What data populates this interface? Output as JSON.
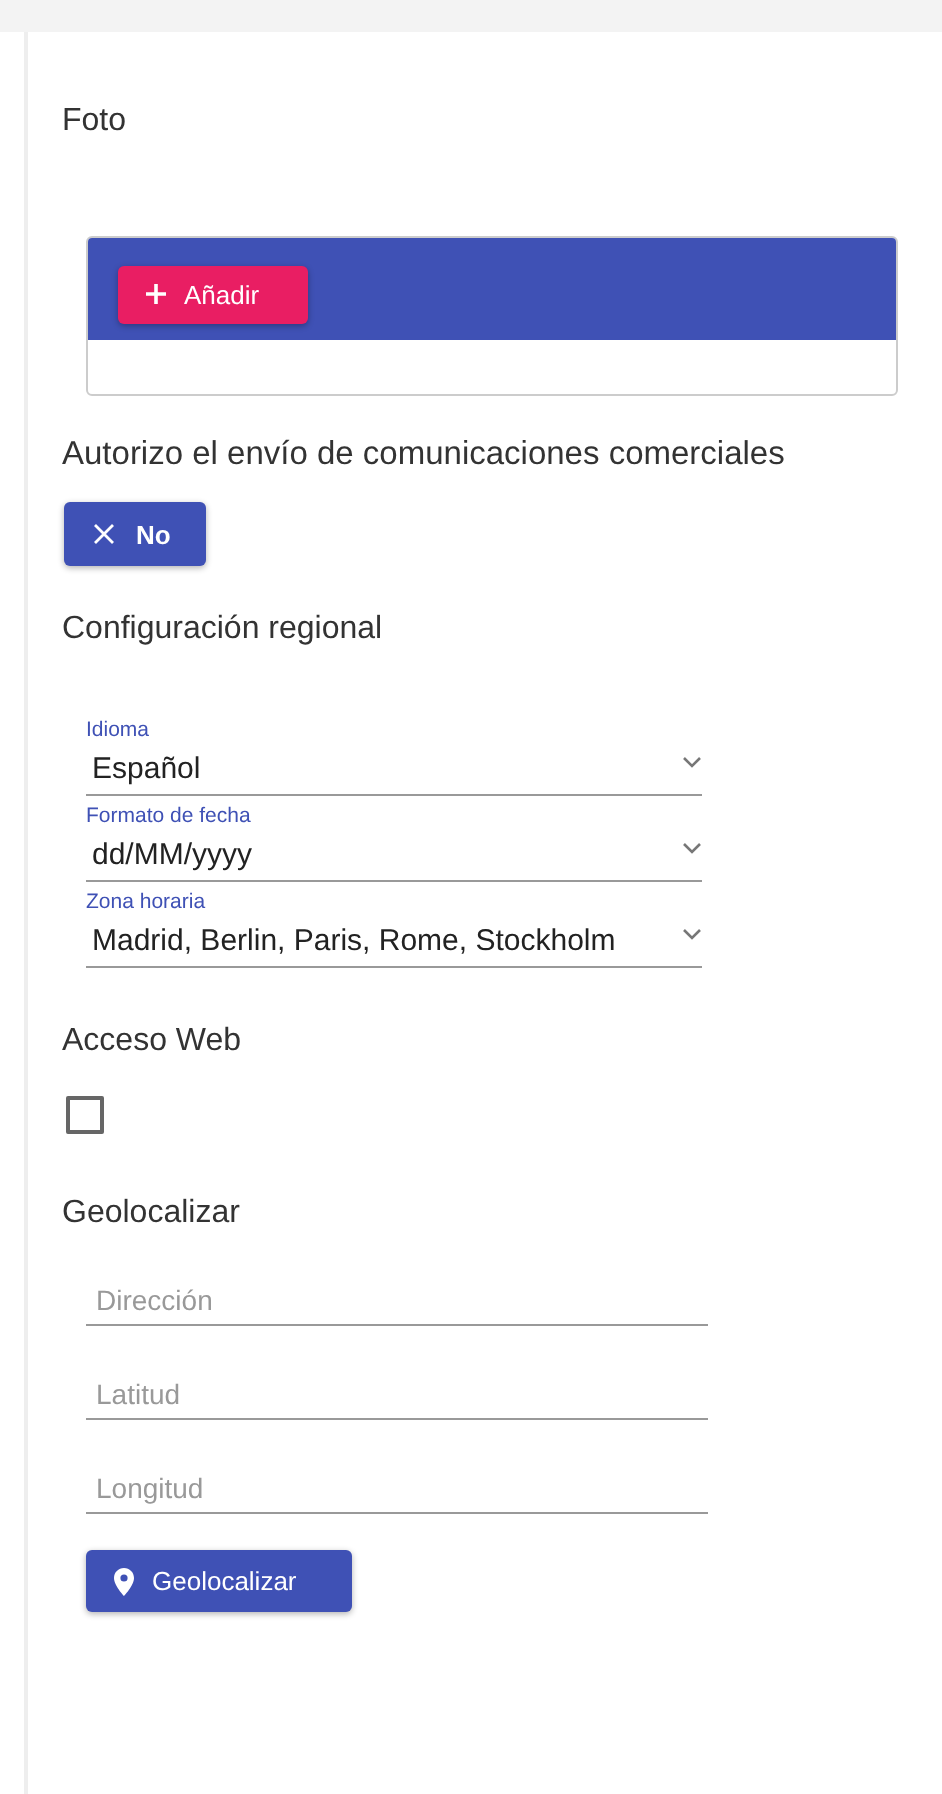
{
  "photo": {
    "title": "Foto",
    "add_button": "Añadir"
  },
  "consent": {
    "title": "Autorizo el envío de comunicaciones comerciales",
    "toggle": {
      "label": "No",
      "on": false
    }
  },
  "regional": {
    "title": "Configuración regional",
    "selects": [
      {
        "label": "Idioma",
        "value": "Español"
      },
      {
        "label": "Formato de fecha",
        "value": "dd/MM/yyyy"
      },
      {
        "label": "Zona horaria",
        "value": "Madrid, Berlin, Paris, Rome, Stockholm"
      }
    ]
  },
  "web_access": {
    "title": "Acceso Web",
    "checked": false
  },
  "geolocate": {
    "title": "Geolocalizar",
    "fields": [
      {
        "placeholder": "Dirección"
      },
      {
        "placeholder": "Latitud"
      },
      {
        "placeholder": "Longitud"
      }
    ],
    "button": "Geolocalizar"
  }
}
